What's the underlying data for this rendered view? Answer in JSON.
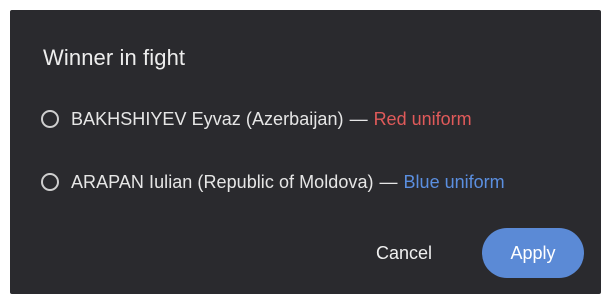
{
  "dialog": {
    "title": "Winner in fight",
    "options": [
      {
        "label": "BAKHSHIYEV Eyvaz (Azerbaijan)",
        "separator": "—",
        "uniform": "Red uniform",
        "uniform_color": "#e05a5a",
        "selected": false
      },
      {
        "label": "ARAPAN Iulian (Republic of Moldova)",
        "separator": "—",
        "uniform": "Blue uniform",
        "uniform_color": "#5b8fe0",
        "selected": false
      }
    ],
    "cancel_label": "Cancel",
    "apply_label": "Apply",
    "accent_color": "#5b8ad6",
    "background_color": "#2a2a2e"
  }
}
